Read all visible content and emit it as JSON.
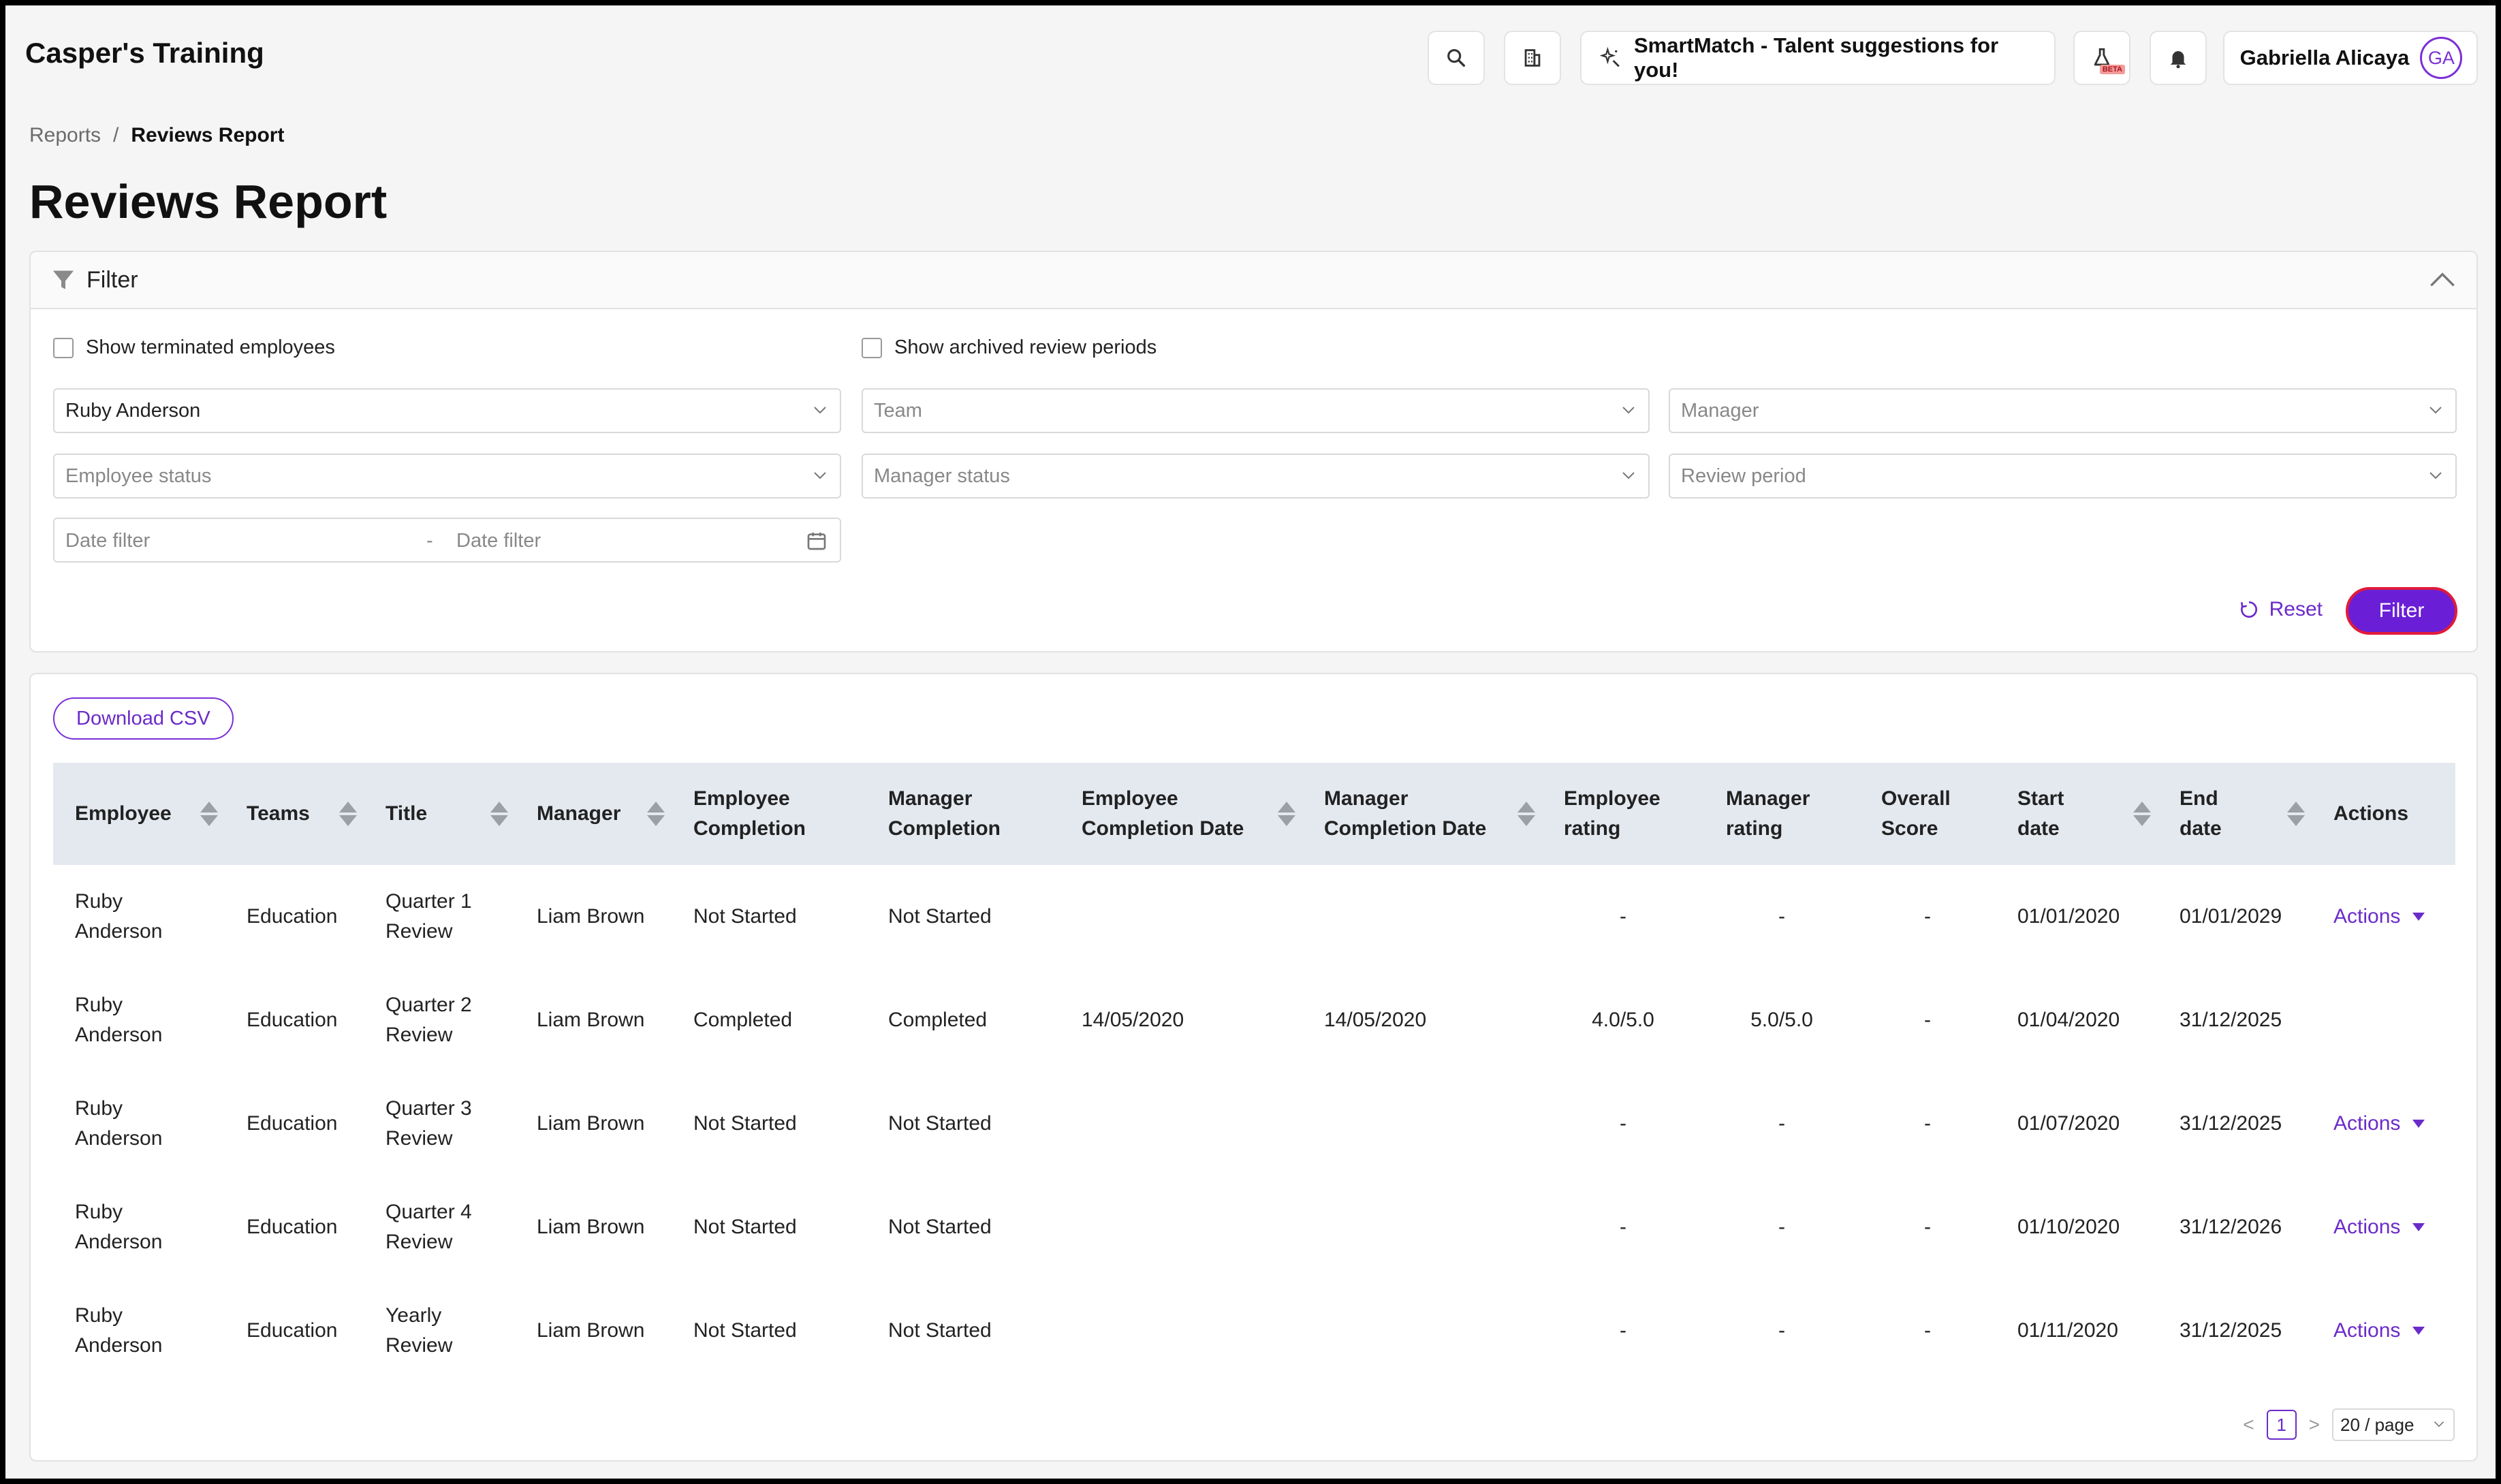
{
  "app": {
    "brand": "Casper's Training"
  },
  "header": {
    "smartmatch_label": "SmartMatch - Talent suggestions for you!",
    "beta_label": "BETA",
    "user_name": "Gabriella Alicaya",
    "user_initials": "GA"
  },
  "breadcrumb": {
    "parent": "Reports",
    "separator": "/",
    "current": "Reviews Report"
  },
  "page": {
    "title": "Reviews Report"
  },
  "filter": {
    "title": "Filter",
    "show_terminated_label": "Show terminated employees",
    "show_archived_label": "Show archived review periods",
    "employee_value": "Ruby Anderson",
    "team_placeholder": "Team",
    "manager_placeholder": "Manager",
    "employee_status_placeholder": "Employee status",
    "manager_status_placeholder": "Manager status",
    "review_period_placeholder": "Review period",
    "date_from_placeholder": "Date filter",
    "date_sep": "-",
    "date_to_placeholder": "Date filter",
    "reset_label": "Reset",
    "filter_label": "Filter"
  },
  "results": {
    "download_csv_label": "Download CSV",
    "columns": {
      "employee": "Employee",
      "teams": "Teams",
      "title": "Title",
      "manager": "Manager",
      "emp_completion": [
        "Employee",
        "Completion"
      ],
      "mgr_completion": [
        "Manager",
        "Completion"
      ],
      "emp_completion_date": [
        "Employee",
        "Completion Date"
      ],
      "mgr_completion_date": [
        "Manager",
        "Completion Date"
      ],
      "emp_rating": [
        "Employee",
        "rating"
      ],
      "mgr_rating": [
        "Manager",
        "rating"
      ],
      "overall_score": [
        "Overall",
        "Score"
      ],
      "start_date": [
        "Start",
        "date"
      ],
      "end_date": [
        "End",
        "date"
      ],
      "actions": "Actions"
    },
    "rows": [
      {
        "employee": [
          "Ruby",
          "Anderson"
        ],
        "team": "Education",
        "title": [
          "Quarter 1",
          "Review"
        ],
        "manager": "Liam Brown",
        "emp_completion": "Not Started",
        "mgr_completion": "Not Started",
        "emp_date": "",
        "mgr_date": "",
        "emp_rating": "-",
        "mgr_rating": "-",
        "overall": "-",
        "start": "01/01/2020",
        "end": "01/01/2029",
        "actions": "Actions"
      },
      {
        "employee": [
          "Ruby",
          "Anderson"
        ],
        "team": "Education",
        "title": [
          "Quarter 2",
          "Review"
        ],
        "manager": "Liam Brown",
        "emp_completion": "Completed",
        "mgr_completion": "Completed",
        "emp_date": "14/05/2020",
        "mgr_date": "14/05/2020",
        "emp_rating": "4.0/5.0",
        "mgr_rating": "5.0/5.0",
        "overall": "-",
        "start": "01/04/2020",
        "end": "31/12/2025",
        "actions": ""
      },
      {
        "employee": [
          "Ruby",
          "Anderson"
        ],
        "team": "Education",
        "title": [
          "Quarter 3",
          "Review"
        ],
        "manager": "Liam Brown",
        "emp_completion": "Not Started",
        "mgr_completion": "Not Started",
        "emp_date": "",
        "mgr_date": "",
        "emp_rating": "-",
        "mgr_rating": "-",
        "overall": "-",
        "start": "01/07/2020",
        "end": "31/12/2025",
        "actions": "Actions"
      },
      {
        "employee": [
          "Ruby",
          "Anderson"
        ],
        "team": "Education",
        "title": [
          "Quarter 4",
          "Review"
        ],
        "manager": "Liam Brown",
        "emp_completion": "Not Started",
        "mgr_completion": "Not Started",
        "emp_date": "",
        "mgr_date": "",
        "emp_rating": "-",
        "mgr_rating": "-",
        "overall": "-",
        "start": "01/10/2020",
        "end": "31/12/2026",
        "actions": "Actions"
      },
      {
        "employee": [
          "Ruby",
          "Anderson"
        ],
        "team": "Education",
        "title": [
          "Yearly",
          "Review"
        ],
        "manager": "Liam Brown",
        "emp_completion": "Not Started",
        "mgr_completion": "Not Started",
        "emp_date": "",
        "mgr_date": "",
        "emp_rating": "-",
        "mgr_rating": "-",
        "overall": "-",
        "start": "01/11/2020",
        "end": "31/12/2025",
        "actions": "Actions"
      }
    ]
  },
  "pagination": {
    "prev": "<",
    "current_page": "1",
    "next": ">",
    "page_size": "20 / page"
  },
  "colors": {
    "accent": "#6a1fd6",
    "danger_outline": "#e01b3a",
    "header_row": "#e4e9f0"
  }
}
